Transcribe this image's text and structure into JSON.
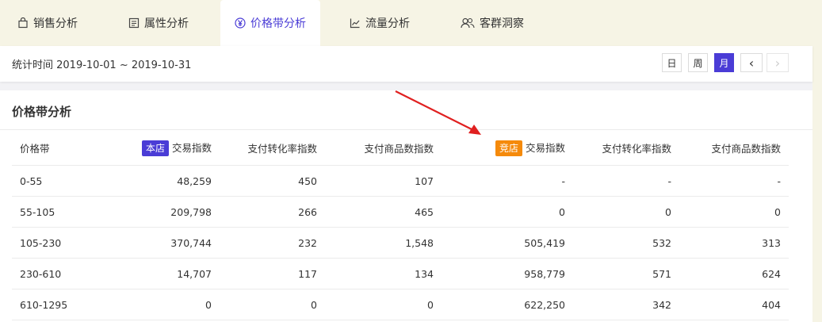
{
  "tabs": [
    {
      "label": "销售分析",
      "icon": "bag-icon"
    },
    {
      "label": "属性分析",
      "icon": "list-icon"
    },
    {
      "label": "价格带分析",
      "icon": "yen-icon",
      "active": true
    },
    {
      "label": "流量分析",
      "icon": "line-chart-icon"
    },
    {
      "label": "客群洞察",
      "icon": "users-icon"
    }
  ],
  "date_bar": {
    "stat_time": "统计时间 2019-10-01 ~ 2019-10-31",
    "buttons": [
      "日",
      "周",
      "月"
    ],
    "active_button": "月",
    "prev": "‹",
    "next": "›"
  },
  "section": {
    "title": "价格带分析",
    "own_badge": "本店",
    "comp_badge": "竞店",
    "columns": [
      "价格带",
      "交易指数",
      "支付转化率指数",
      "支付商品数指数",
      "交易指数",
      "支付转化率指数",
      "支付商品数指数"
    ],
    "rows": [
      [
        "0-55",
        "48,259",
        "450",
        "107",
        "-",
        "-",
        "-"
      ],
      [
        "55-105",
        "209,798",
        "266",
        "465",
        "0",
        "0",
        "0"
      ],
      [
        "105-230",
        "370,744",
        "232",
        "1,548",
        "505,419",
        "532",
        "313"
      ],
      [
        "230-610",
        "14,707",
        "117",
        "134",
        "958,779",
        "571",
        "624"
      ],
      [
        "610-1295",
        "0",
        "0",
        "0",
        "622,250",
        "342",
        "404"
      ]
    ]
  },
  "colors": {
    "accent": "#4a3cd6",
    "competitor": "#f58a0b",
    "arrow": "#e02020"
  }
}
